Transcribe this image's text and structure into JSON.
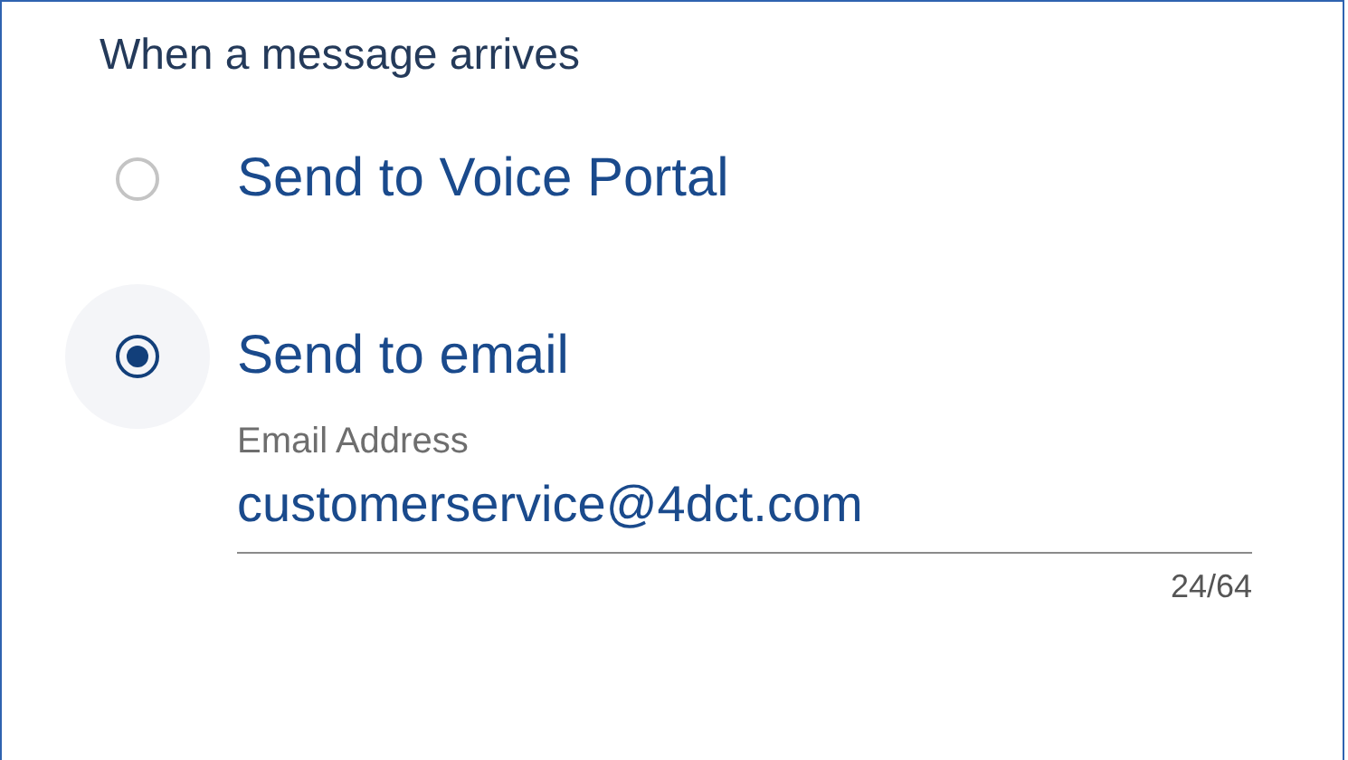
{
  "section": {
    "title": "When a message arrives"
  },
  "options": [
    {
      "label": "Send to Voice Portal",
      "selected": false
    },
    {
      "label": "Send to email",
      "selected": true
    }
  ],
  "email_field": {
    "label": "Email Address",
    "value": "customerservice@4dct.com",
    "counter": "24/64"
  }
}
